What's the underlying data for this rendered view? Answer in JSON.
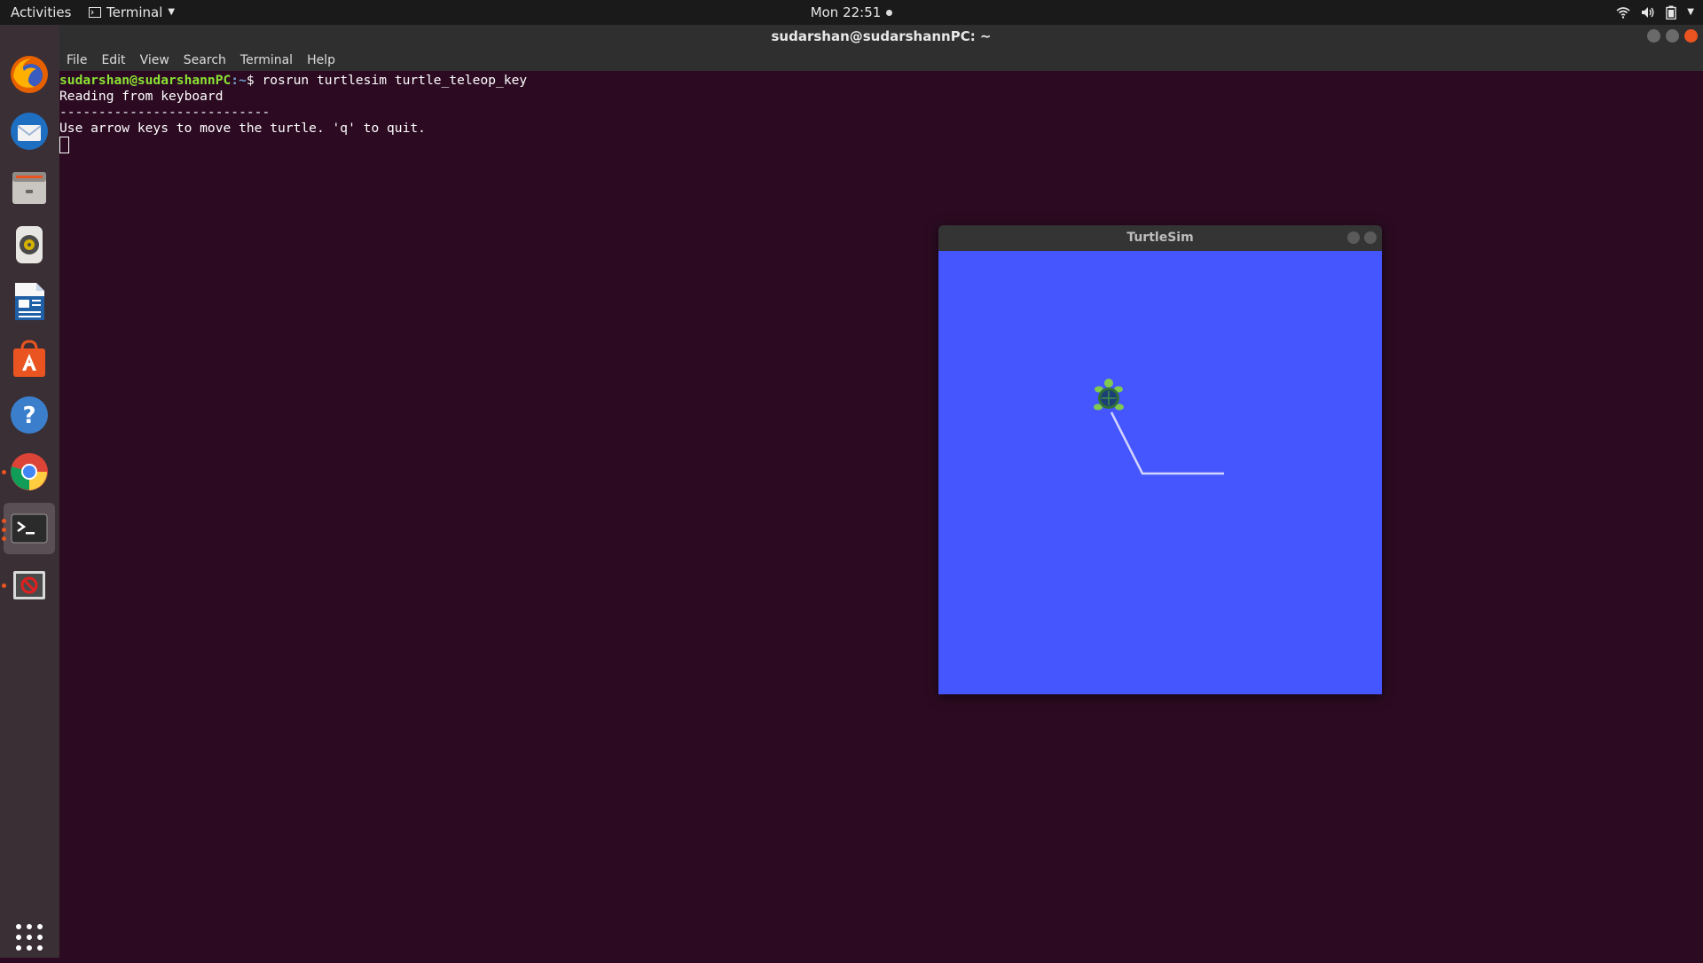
{
  "topbar": {
    "activities": "Activities",
    "app_menu": "Terminal",
    "clock": "Mon 22:51"
  },
  "dock": {
    "items": [
      "Firefox",
      "Thunderbird",
      "Files",
      "Rhythmbox",
      "LibreOffice Writer",
      "Ubuntu Software",
      "Help",
      "Chrome",
      "Terminal",
      "Unknown App"
    ],
    "active": "Terminal"
  },
  "terminal": {
    "title": "sudarshan@sudarshannPC: ~",
    "menu": [
      "File",
      "Edit",
      "View",
      "Search",
      "Terminal",
      "Help"
    ],
    "prompt_user": "sudarshan@sudarshannPC",
    "prompt_path": ":~",
    "prompt_symbol": "$ ",
    "command": "rosrun turtlesim turtle_teleop_key",
    "lines": [
      "Reading from keyboard",
      "---------------------------",
      "Use arrow keys to move the turtle. 'q' to quit."
    ]
  },
  "turtlesim": {
    "title": "TurtleSim",
    "background": "#4556ff",
    "path_color": "#d4d6ff"
  },
  "colors": {
    "terminal_bg": "#2c0b22",
    "prompt_user": "#8ae234",
    "prompt_path": "#729fcf",
    "accent": "#e95420"
  }
}
